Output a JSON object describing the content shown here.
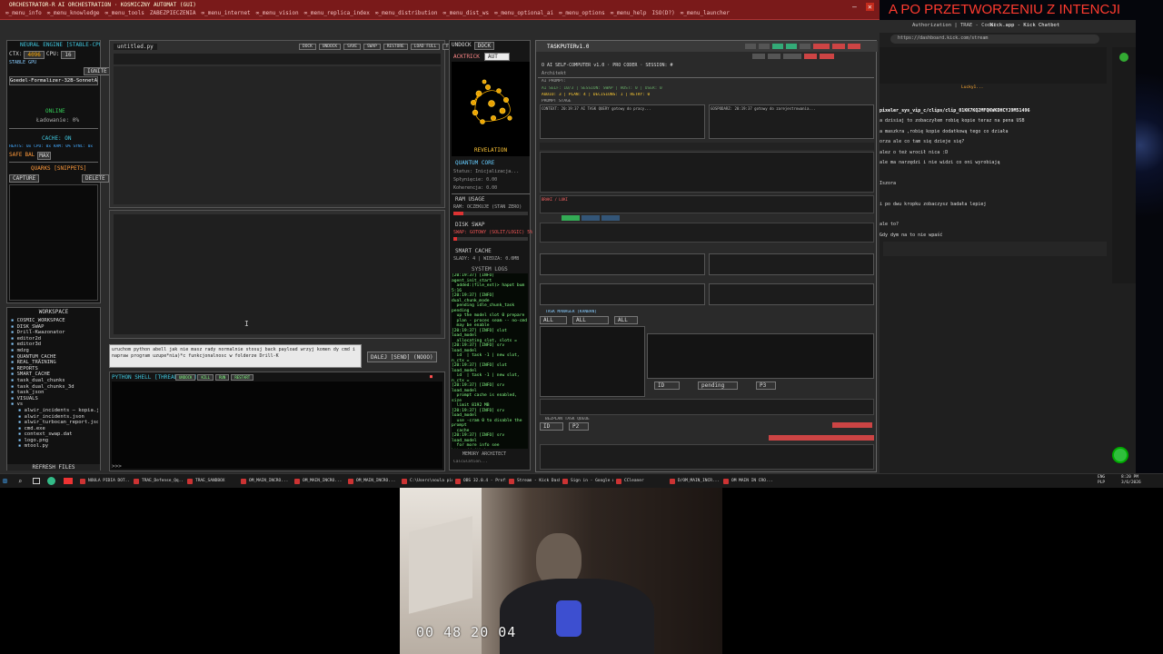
{
  "titlebar": {
    "title": "ORCHESTRATOR-R AI ORCHESTRATION · KOSMICZNY AUTOMAT (GUI)",
    "menu": [
      "∞_menu_info",
      "∞_menu_knowledge",
      "∞_menu_tools",
      "ZABEZPIECZENIA",
      "∞_menu_internet",
      "∞_menu_vision",
      "∞_menu_replica_index",
      "∞_menu_distribution",
      "∞_menu_dist_ws",
      "∞_menu_optional_ai",
      "∞_menu_options",
      "∞_menu_help",
      "ISO(D?)",
      "∞_menu_launcher"
    ],
    "minimize": "–",
    "close": "✕"
  },
  "banner": "A PO PRZETWORZENIU Z INTENCJI",
  "neural": {
    "header": "NEURAL ENGINE [STABLE-CPU]",
    "ctx_label": "CTX:",
    "ctx_value": "4096",
    "cpu_label": "CPU:",
    "cpu_value": "16",
    "stable": "STABLE GPU",
    "ignite": "IGNITE",
    "model": "Goedel-Formalizer-32B-SonnetAnnotated",
    "online": "ONLINE",
    "loading": "Ładowanie: 0%",
    "cache_on": "CACHE: ON",
    "cache_stats": "HEATS: 0x   CPU: 0x   RAM: 0%   SYNC: 0x",
    "safe": "SAFE",
    "bal": "BAL",
    "max": "MAX",
    "quarks": "QUARKS [SNIPPETS]",
    "capture": "CAPTURE",
    "delete": "DELETE"
  },
  "workspace": {
    "header": "WORKSPACE",
    "items": [
      "COSMIC_WORKSPACE",
      "DISK_SWAP",
      "Drill-Kwazonator",
      "editor2d",
      "editor3d",
      "mdzg",
      "QUANTUM_CACHE",
      "REAL_TRAINING",
      "REPORTS",
      "SMART_CACHE",
      "task_dual_chunks",
      "task_dual_chunks_3d",
      "task_json",
      "VISUALS",
      "vs",
      "alwir_incidents — kopia.json",
      "alwir_incidents.json",
      "alwir_turbocan_report.json",
      "cmd.exe",
      "context_swap.dat",
      "logo.png",
      "mtool.py"
    ],
    "refresh": "REFRESH FILES"
  },
  "editor": {
    "tab": "untitled.py",
    "buttons": [
      "DOCK",
      "UNDOCK",
      "SAVE",
      "SWAP",
      "RESTORE",
      "LOAD FULL",
      "FY Aboo2m"
    ],
    "prompt": "uruchom python abell jak nie masz rady normalnie stosuj back payload wrzyj komen dy cmd i napraw program uzupe*nia)*c funkcjonalnosc w folderze Drill-K",
    "send": "DALEJ [SEND] (NOOO)",
    "shell_header": "PYTHON SHELL [THREAD SAFE]",
    "shell_tags": [
      "UNDOCK",
      "KILL",
      "RUN",
      "RESTART"
    ],
    "shell_prompt": ">>>"
  },
  "middle": {
    "undock": "UNDOCK",
    "dock": "DOCK",
    "acktrick": "ACKTRICK",
    "auto": "AUT",
    "revelation": "REVELATION",
    "quantum_core": "QUANTUM CORE",
    "status": "Status: Inicjalizacja...",
    "energy": "Spłynięcie: 0.00",
    "coherence": "Koherencja: 0.00",
    "ram_usage": "RAM USAGE",
    "ram_note": "RAM: OCZEKUJE (STAN ZERO)",
    "disk_swap": "DISK SWAP",
    "swap_note": "SWAP: GOTOWY (SOLIT/LOGIC) 5%",
    "smart_cache": "SMART CACHE",
    "smart_note": "SLADY: 4 | WIEDZA: 0.0MB",
    "system_logs": "SYSTEM LOGS",
    "logs": "[20:19:37] [INFO] agent_init_start\n  added:(file_ext)> hapot bum  5:16\n[20:19:37] [INFO] dual_chunk_mode\n  pending idle_chunk_task pending\n  up the model slot 0 prepare\n  plan - proces seam -- no-cmd\n  may be enable\n[20:19:37] [INFO] slot  load_model\n  allocating slot, slots =\n[20:19:37] [INFO] srv   load_model\n  id  | task -1 | new slot, n_ctx =\n[20:19:37] [INFO] slot  load_model\n  id  | task -1 | new slot, n_ctx =\n[20:19:37] [INFO] srv   load_model\n  prompt cache is enabled, size\n  limit 8192 MB\n[20:19:37] [INFO] srv   load_model\n  use -cram 0 to disable the prompt\n  cache\n[20:19:37] [INFO] srv   load_model\n  for more info see https://github.com\n  /ggml-org/llama.cpp/pull/16391\n[20:19:37] [INFO] init: chat template\n[20:19:37] [INFO] load_model: chat\n  update_chat_template (3, 16 Emile\n  all slots are idle\n[20:19:37] [INFO] srv update_slots:\n  all slots are idle",
    "memory": "MEMORY ARCHITECT",
    "calc": "Calculation..."
  },
  "taskputer": {
    "title": "TASKPUTER",
    "version": "v1.0",
    "subtitle": "O AI SELF-COMPUTER v1.0 · PRO CODER · SESSION: #",
    "architect": "Architekt",
    "ai_prompt": "AI PROMPT:",
    "lines": [
      "AI SELF: 10/3  |  SESSION: SWAP  |  HOST: 0  |  USER: 0",
      "AUDIO: 3  |  PLAN: 4  |  DECISIONS: 1  |  RETRY: 0",
      "PROMPT STAGE",
      "CONTEXT: 20:19:37 AI TASK QUERY gotowy do pracy...",
      "GOSPODARZ: 20:19:37 gotowy do zarejestrowania..."
    ],
    "gaps": [
      "BRAKI / LUKI",
      "RUN",
      "ZARZADZAJ"
    ],
    "task_manager": "TASK MANAGER [KANBAN]",
    "filters": [
      "ALL",
      "ALL",
      "ALL"
    ],
    "status_opts": [
      "ID",
      "pending",
      "P3"
    ],
    "queue": "BEZPLAN TASK QUEUE",
    "queue_opts": [
      "ID",
      "P2"
    ]
  },
  "browser": {
    "tabs": [
      "Authorization | TRAE - Coder",
      "Kick.app - Kick Chatbot"
    ],
    "url": "https://dashboard.kick.com/stream",
    "user": "Lucky1...",
    "chat": [
      "pixeler_sys_vip_c/clips/clip_01KK7KQ2MFQKWKDHCYJ9M51496",
      "a dzisiaj to zobaczyłem robię kopie teraz na pena USB",
      "a maszkra ,robię kopie dodatkową tego co działa",
      "orza ale co tam się dzieje się?",
      "alez o też wrocił nica :D",
      "ale ma narzędzi i nie widzi co oni wyrobiają",
      "",
      "Iszora",
      "",
      "i po dwu kropku zobaczysz badała lepiej",
      "",
      "ale to?",
      "Gdy dym na to nie wpaść"
    ]
  },
  "taskbar": {
    "items": [
      "NOULA PIDIA DOT...",
      "TRAE_Defense_Qq...",
      "TRAE_SANDBOX",
      "OM_MAIN_INCRO...",
      "OM_MAIN_INCRO...",
      "OM_MAIN_INCRO...",
      "C:\\Users\\noula pid...",
      "OBS 32.0.4 - Profile...",
      "Stream - Kick Dash...",
      "Sign in - Google Ac...",
      "CCleaner",
      "D/OM_MAIN_INCR...",
      "OM MAIN IN CRO..."
    ],
    "lang": "ENG\nPLP",
    "time": "8:20 PM\n3/6/2026"
  },
  "webcam": {
    "timer": "00 48 20 04"
  },
  "colors": {
    "accent_red": "#ff3b2f",
    "online_green": "#34d058",
    "cyan": "#40c8e0"
  }
}
